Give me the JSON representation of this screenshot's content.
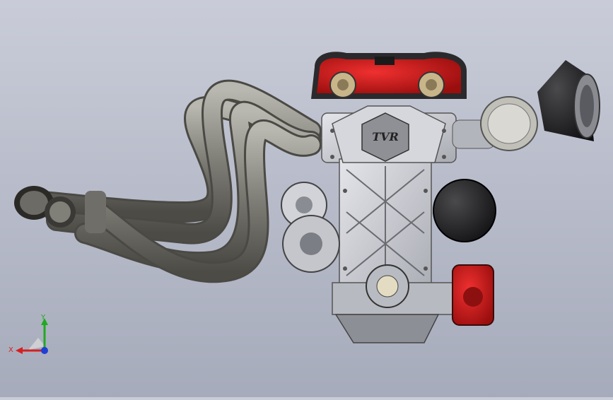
{
  "viewport": {
    "background_top": "#c9ccd8",
    "background_bottom": "#a6abbb",
    "model": {
      "logo_text": "TVR",
      "accent_color": "#d31a1a",
      "metal_color": "#c7c9cf",
      "dark_color": "#2a2a2c",
      "pipe_color": "#8c8b84"
    }
  },
  "triad": {
    "x_label": "X",
    "y_label": "Y",
    "x_color": "#d42020",
    "y_color": "#1faa1f",
    "z_color": "#1f3fd4"
  }
}
